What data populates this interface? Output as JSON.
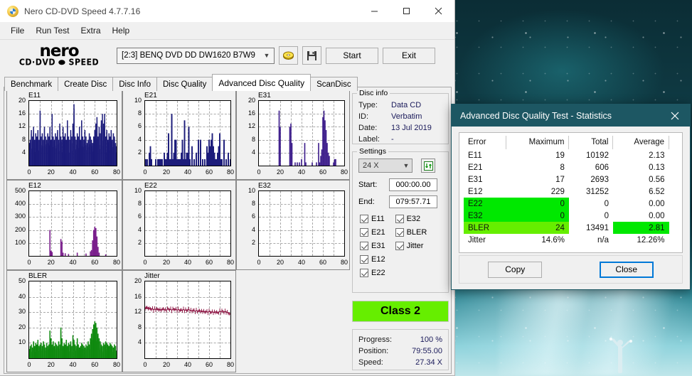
{
  "window": {
    "title": "Nero CD-DVD Speed 4.7.7.16",
    "icon": "nero-disc-icon",
    "minimize": "–",
    "maximize": "□",
    "close": "✕"
  },
  "menu": {
    "items": [
      "File",
      "Run Test",
      "Extra",
      "Help"
    ]
  },
  "logo": {
    "word": "nero",
    "sub": "CD·DVD ⬬ SPEED"
  },
  "toolbar": {
    "drive": "[2:3]   BENQ DVD DD DW1620 B7W9",
    "eject_icon": "disc-eject-icon",
    "save_icon": "floppy-save-icon",
    "start_label": "Start",
    "exit_label": "Exit"
  },
  "tabs": [
    {
      "label": "Benchmark",
      "active": false
    },
    {
      "label": "Create Disc",
      "active": false
    },
    {
      "label": "Disc Info",
      "active": false
    },
    {
      "label": "Disc Quality",
      "active": false
    },
    {
      "label": "Advanced Disc Quality",
      "active": true
    },
    {
      "label": "ScanDisc",
      "active": false
    }
  ],
  "disc_info": {
    "legend": "Disc info",
    "rows": [
      {
        "key": "Type:",
        "value": "Data CD"
      },
      {
        "key": "ID:",
        "value": "Verbatim"
      },
      {
        "key": "Date:",
        "value": "13 Jul 2019"
      },
      {
        "key": "Label:",
        "value": "-"
      }
    ]
  },
  "settings": {
    "legend": "Settings",
    "speed": "24 X",
    "refresh_icon": "refresh-icon",
    "start_label": "Start:",
    "start_value": "000:00.00",
    "end_label": "End:",
    "end_value": "079:57.71",
    "checkboxes_col1": [
      "E11",
      "E21",
      "E31",
      "E12",
      "E22"
    ],
    "checkboxes_col2": [
      "E32",
      "BLER",
      "Jitter"
    ]
  },
  "class_badge": {
    "label": "Class 2",
    "color": "#66ee00"
  },
  "progress": {
    "rows": [
      {
        "key": "Progress:",
        "value": "100 %"
      },
      {
        "key": "Position:",
        "value": "79:55.00"
      },
      {
        "key": "Speed:",
        "value": "27.34 X"
      }
    ]
  },
  "stats_dialog": {
    "title": "Advanced Disc Quality Test - Statistics",
    "close_icon": "close-icon",
    "headers": [
      "Error",
      "Maximum",
      "Total",
      "Average"
    ],
    "rows": [
      {
        "error": "E11",
        "maximum": "19",
        "total": "10192",
        "average": "2.13",
        "hl_left": false,
        "hl_avg": false
      },
      {
        "error": "E21",
        "maximum": "8",
        "total": "606",
        "average": "0.13",
        "hl_left": false,
        "hl_avg": false
      },
      {
        "error": "E31",
        "maximum": "17",
        "total": "2693",
        "average": "0.56",
        "hl_left": false,
        "hl_avg": false
      },
      {
        "error": "E12",
        "maximum": "229",
        "total": "31252",
        "average": "6.52",
        "hl_left": false,
        "hl_avg": false
      },
      {
        "error": "E22",
        "maximum": "0",
        "total": "0",
        "average": "0.00",
        "hl_left": "bright",
        "hl_avg": false
      },
      {
        "error": "E32",
        "maximum": "0",
        "total": "0",
        "average": "0.00",
        "hl_left": "bright",
        "hl_avg": false
      },
      {
        "error": "BLER",
        "maximum": "24",
        "total": "13491",
        "average": "2.81",
        "hl_left": "light",
        "hl_avg": "bright"
      },
      {
        "error": "Jitter",
        "maximum": "14.6%",
        "total": "n/a",
        "average": "12.26%",
        "hl_left": false,
        "hl_avg": false
      }
    ],
    "copy_label": "Copy",
    "close_label": "Close"
  },
  "chart_data": [
    {
      "type": "bar",
      "title": "E11",
      "xlabel": "",
      "ylabel": "",
      "xlim": [
        0,
        80
      ],
      "ylim": [
        0,
        20
      ],
      "grid": true,
      "xticks": [
        0,
        20,
        40,
        60,
        80
      ],
      "yticks": [
        4,
        8,
        12,
        16,
        20
      ],
      "color": "#1c1c7a",
      "x": [
        0,
        1,
        2,
        3,
        4,
        5,
        6,
        7,
        8,
        9,
        10,
        11,
        12,
        13,
        14,
        15,
        16,
        17,
        18,
        19,
        20,
        21,
        22,
        23,
        24,
        25,
        26,
        27,
        28,
        29,
        30,
        31,
        32,
        33,
        34,
        35,
        36,
        37,
        38,
        39,
        40,
        41,
        42,
        43,
        44,
        45,
        46,
        47,
        48,
        49,
        50,
        51,
        52,
        53,
        54,
        55,
        56,
        57,
        58,
        59,
        60,
        61,
        62,
        63,
        64,
        65,
        66,
        67,
        68,
        69,
        70,
        71,
        72,
        73,
        74,
        75,
        76,
        77,
        78,
        79,
        80
      ],
      "values": [
        7,
        8,
        11,
        9,
        12,
        8,
        10,
        9,
        11,
        8,
        17,
        9,
        10,
        8,
        12,
        9,
        8,
        10,
        9,
        12,
        8,
        16,
        9,
        8,
        10,
        9,
        11,
        8,
        13,
        9,
        8,
        12,
        9,
        10,
        8,
        14,
        9,
        8,
        11,
        9,
        13,
        19,
        9,
        8,
        10,
        9,
        12,
        8,
        14,
        9,
        8,
        11,
        9,
        7,
        8,
        10,
        9,
        8,
        7,
        9,
        11,
        13,
        15,
        9,
        12,
        10,
        14,
        16,
        13,
        16,
        9,
        11,
        8,
        10,
        9,
        11,
        8,
        10,
        9,
        7,
        6
      ]
    },
    {
      "type": "bar",
      "title": "E21",
      "xlim": [
        0,
        80
      ],
      "ylim": [
        0,
        10
      ],
      "grid": true,
      "xticks": [
        0,
        20,
        40,
        60,
        80
      ],
      "yticks": [
        2,
        4,
        6,
        8,
        10
      ],
      "color": "#1c1c7a",
      "x": [
        0,
        2,
        4,
        5,
        6,
        8,
        10,
        12,
        13,
        14,
        15,
        16,
        18,
        19,
        20,
        21,
        22,
        23,
        24,
        25,
        26,
        27,
        28,
        29,
        30,
        31,
        32,
        33,
        34,
        35,
        36,
        37,
        38,
        39,
        40,
        41,
        42,
        44,
        46,
        48,
        50,
        52,
        54,
        56,
        58,
        59,
        60,
        61,
        62,
        63,
        64,
        65,
        66,
        67,
        68,
        69,
        70,
        71,
        72,
        74,
        76,
        78,
        80
      ],
      "values": [
        1,
        1,
        2,
        3,
        1,
        0,
        1,
        1,
        1,
        1,
        1,
        1,
        2,
        1,
        1,
        2,
        5,
        1,
        1,
        8,
        1,
        2,
        4,
        4,
        1,
        1,
        1,
        1,
        2,
        4,
        1,
        7,
        1,
        2,
        2,
        6,
        1,
        3,
        1,
        2,
        4,
        4,
        1,
        1,
        3,
        2,
        4,
        3,
        4,
        5,
        3,
        2,
        1,
        1,
        2,
        3,
        5,
        1,
        1,
        4,
        1,
        2,
        1
      ]
    },
    {
      "type": "bar",
      "title": "E31",
      "xlim": [
        0,
        80
      ],
      "ylim": [
        0,
        20
      ],
      "grid": true,
      "xticks": [
        0,
        20,
        40,
        60,
        80
      ],
      "yticks": [
        4,
        8,
        12,
        16,
        20
      ],
      "color": "#3a1a8a",
      "x": [
        19,
        20,
        29,
        30,
        31,
        34,
        36,
        38,
        40,
        43,
        44,
        50,
        54,
        56,
        57,
        58,
        59,
        60,
        61,
        62,
        63,
        64,
        65,
        66,
        70,
        71,
        72
      ],
      "values": [
        17,
        12,
        12,
        13,
        7,
        1,
        1,
        1,
        2,
        7,
        1,
        1,
        1,
        7,
        1,
        3,
        5,
        15,
        17,
        14,
        11,
        7,
        4,
        3,
        1,
        2,
        2
      ]
    },
    {
      "type": "bar",
      "title": "E12",
      "xlim": [
        0,
        80
      ],
      "ylim": [
        0,
        500
      ],
      "grid": true,
      "xticks": [
        0,
        20,
        40,
        60,
        80
      ],
      "yticks": [
        100,
        200,
        300,
        400,
        500
      ],
      "color": "#7a1f8c",
      "x": [
        19,
        20,
        21,
        29,
        30,
        31,
        33,
        36,
        44,
        52,
        56,
        57,
        58,
        59,
        60,
        61,
        62,
        63,
        64,
        70
      ],
      "values": [
        200,
        40,
        30,
        130,
        110,
        25,
        20,
        15,
        25,
        18,
        35,
        45,
        120,
        200,
        225,
        215,
        150,
        70,
        25,
        12
      ]
    },
    {
      "type": "bar",
      "title": "E22",
      "xlim": [
        0,
        80
      ],
      "ylim": [
        0,
        10
      ],
      "grid": true,
      "xticks": [
        0,
        20,
        40,
        60,
        80
      ],
      "yticks": [
        2,
        4,
        6,
        8,
        10
      ],
      "color": "#1c1c7a",
      "x": [],
      "values": []
    },
    {
      "type": "bar",
      "title": "E32",
      "xlim": [
        0,
        80
      ],
      "ylim": [
        0,
        10
      ],
      "grid": true,
      "xticks": [
        0,
        20,
        40,
        60,
        80
      ],
      "yticks": [
        2,
        4,
        6,
        8,
        10
      ],
      "color": "#1c1c7a",
      "x": [],
      "values": []
    },
    {
      "type": "bar",
      "title": "BLER",
      "xlim": [
        0,
        80
      ],
      "ylim": [
        0,
        50
      ],
      "grid": true,
      "xticks": [
        0,
        20,
        40,
        60,
        80
      ],
      "yticks": [
        10,
        20,
        30,
        40,
        50
      ],
      "color": "#108a10",
      "x": [
        0,
        1,
        2,
        3,
        4,
        5,
        6,
        7,
        8,
        9,
        10,
        11,
        12,
        13,
        14,
        15,
        16,
        17,
        18,
        19,
        20,
        21,
        22,
        23,
        24,
        25,
        26,
        27,
        28,
        29,
        30,
        31,
        32,
        33,
        34,
        35,
        36,
        37,
        38,
        39,
        40,
        41,
        42,
        43,
        44,
        45,
        46,
        47,
        48,
        49,
        50,
        51,
        52,
        53,
        54,
        55,
        56,
        57,
        58,
        59,
        60,
        61,
        62,
        63,
        64,
        65,
        66,
        67,
        68,
        69,
        70,
        71,
        72,
        73,
        74,
        75,
        76,
        77,
        78,
        79,
        80
      ],
      "values": [
        6,
        8,
        9,
        7,
        11,
        8,
        10,
        9,
        12,
        8,
        9,
        10,
        8,
        11,
        9,
        7,
        10,
        8,
        9,
        18,
        13,
        9,
        11,
        8,
        10,
        9,
        8,
        11,
        9,
        20,
        13,
        8,
        10,
        9,
        12,
        8,
        10,
        9,
        11,
        8,
        15,
        12,
        9,
        8,
        13,
        9,
        7,
        8,
        10,
        9,
        8,
        7,
        9,
        8,
        11,
        9,
        13,
        16,
        19,
        22,
        24,
        23,
        20,
        16,
        13,
        11,
        9,
        8,
        10,
        9,
        11,
        10,
        9,
        8,
        10,
        9,
        8,
        7,
        9,
        8,
        5
      ]
    },
    {
      "type": "line",
      "title": "Jitter",
      "xlim": [
        0,
        80
      ],
      "ylim": [
        0,
        20
      ],
      "grid": true,
      "xticks": [
        0,
        20,
        40,
        60,
        80
      ],
      "yticks": [
        4,
        8,
        12,
        16,
        20
      ],
      "color": "#8c1040",
      "x": [
        0,
        1,
        2,
        3,
        4,
        5,
        6,
        7,
        8,
        9,
        10,
        11,
        12,
        13,
        14,
        15,
        16,
        17,
        18,
        19,
        20,
        21,
        22,
        23,
        24,
        25,
        26,
        27,
        28,
        29,
        30,
        31,
        32,
        33,
        34,
        35,
        36,
        37,
        38,
        39,
        40,
        41,
        42,
        43,
        44,
        45,
        46,
        47,
        48,
        49,
        50,
        51,
        52,
        53,
        54,
        55,
        56,
        57,
        58,
        59,
        60,
        61,
        62,
        63,
        64,
        65,
        66,
        67,
        68,
        69,
        70,
        71,
        72,
        73,
        74,
        75,
        76,
        77,
        78,
        79,
        80
      ],
      "values": [
        12.8,
        13.4,
        12.9,
        13.2,
        12.8,
        13.0,
        12.7,
        12.9,
        12.6,
        12.8,
        12.7,
        12.9,
        12.6,
        12.8,
        12.5,
        12.7,
        12.6,
        12.9,
        12.7,
        12.5,
        12.6,
        12.8,
        12.9,
        12.6,
        12.8,
        12.5,
        12.7,
        12.9,
        12.6,
        12.8,
        12.5,
        12.7,
        12.6,
        12.4,
        12.6,
        12.5,
        12.7,
        12.5,
        12.6,
        12.4,
        12.6,
        12.7,
        12.5,
        12.4,
        12.3,
        12.5,
        12.4,
        12.2,
        12.4,
        12.3,
        12.2,
        12.4,
        12.3,
        12.1,
        12.3,
        12.2,
        12.0,
        12.2,
        12.1,
        12.0,
        12.2,
        12.1,
        11.9,
        12.1,
        12.0,
        11.9,
        12.1,
        12.0,
        11.8,
        12.0,
        12.2,
        12.1,
        12.3,
        12.2,
        12.0,
        12.2,
        12.1,
        11.9,
        11.8,
        11.6,
        11.5
      ]
    }
  ]
}
